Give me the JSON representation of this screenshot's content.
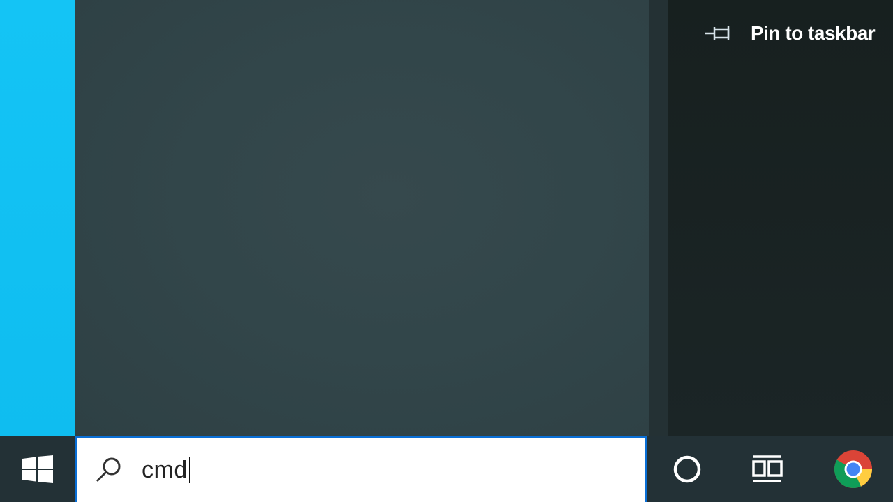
{
  "context_menu": {
    "pin_label": "Pin to taskbar",
    "pin_icon": "pin-icon"
  },
  "taskbar": {
    "start_icon": "windows-logo-icon",
    "search": {
      "value": "cmd",
      "icon": "search-icon"
    },
    "cortana_icon": "cortana-circle-icon",
    "task_view_icon": "task-view-icon",
    "pinned_apps": [
      {
        "icon": "chrome-icon"
      }
    ]
  },
  "colors": {
    "accent_blue": "#0a6fd6",
    "desktop_cyan": "#14c4f5",
    "panel": "#32464a",
    "taskbar": "#233136"
  }
}
